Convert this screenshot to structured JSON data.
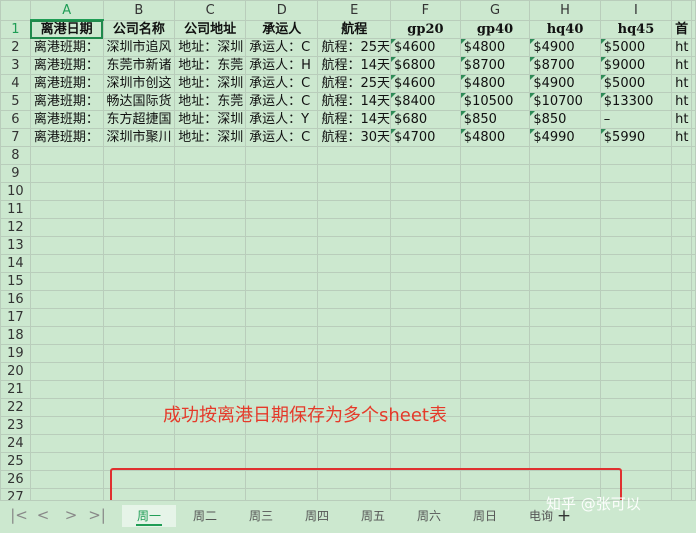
{
  "columns": [
    "A",
    "B",
    "C",
    "D",
    "E",
    "F",
    "G",
    "H",
    "I",
    ""
  ],
  "header_row": [
    "离港日期",
    "公司名称",
    "公司地址",
    "承运人",
    "航程",
    "gp20",
    "gp40",
    "hq40",
    "hq45",
    "首"
  ],
  "rows": [
    [
      "离港班期：",
      "深圳市追风",
      "地址：深圳",
      "承运人：C",
      "航程：25天",
      "$4600",
      "$4800",
      "$4900",
      "$5000",
      "ht"
    ],
    [
      "离港班期：",
      "东莞市新诸",
      "地址：东莞",
      "承运人：H",
      "航程：14天",
      "$6800",
      "$8700",
      "$8700",
      "$9000",
      "ht"
    ],
    [
      "离港班期：",
      "深圳市创这",
      "地址：深圳",
      "承运人：C",
      "航程：25天",
      "$4600",
      "$4800",
      "$4900",
      "$5000",
      "ht"
    ],
    [
      "离港班期：",
      "畅达国际货",
      "地址：东莞",
      "承运人：C",
      "航程：14天",
      "$8400",
      "$10500",
      "$10700",
      "$13300",
      "ht"
    ],
    [
      "离港班期：",
      "东方超捷国",
      "地址：深圳",
      "承运人：Y",
      "航程：14天",
      "$680",
      "$850",
      "$850",
      "–",
      "ht"
    ],
    [
      "离港班期：",
      "深圳市聚川",
      "地址：深圳",
      "承运人：C",
      "航程：30天",
      "$4700",
      "$4800",
      "$4990",
      "$5990",
      "ht"
    ]
  ],
  "row_numbers": [
    "1",
    "2",
    "3",
    "4",
    "5",
    "6",
    "7",
    "8",
    "9",
    "10",
    "11",
    "12",
    "13",
    "14",
    "15",
    "16",
    "17",
    "18",
    "19",
    "20",
    "21",
    "22",
    "23",
    "24",
    "25",
    "26",
    "27"
  ],
  "sheet_tabs": [
    "周一",
    "周二",
    "周三",
    "周四",
    "周五",
    "周六",
    "周日",
    "电询"
  ],
  "active_tab": "周一",
  "add_sheet_label": "+",
  "nav": {
    "first": "|<",
    "prev": "<",
    "next": ">",
    "last": ">|"
  },
  "caption": "成功按离港日期保存为多个sheet表",
  "watermark": "知乎 @张可以",
  "colors": {
    "grid_bg": "#cce8cf",
    "accent": "#1f9d55",
    "caption": "#e53a2a",
    "highlight_box": "#e03030"
  }
}
